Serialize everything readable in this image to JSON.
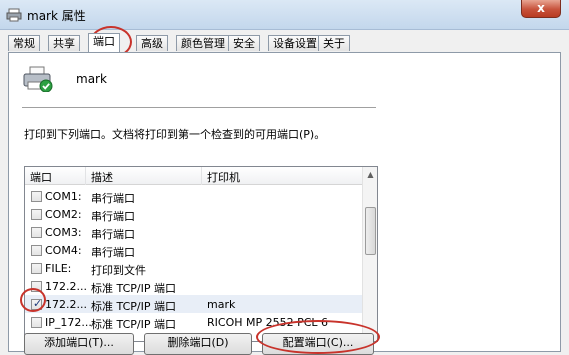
{
  "window": {
    "title": "mark 属性",
    "close_label": "x"
  },
  "tabs": [
    {
      "label": "常规"
    },
    {
      "label": "共享"
    },
    {
      "label": "端口"
    },
    {
      "label": "高级"
    },
    {
      "label": "颜色管理"
    },
    {
      "label": "安全"
    },
    {
      "label": "设备设置"
    },
    {
      "label": "关于"
    }
  ],
  "active_tab": "端口",
  "printer": {
    "name": "mark",
    "icon": "printer-icon"
  },
  "instruction": "打印到下列端口。文档将打印到第一个检查到的可用端口(P)。",
  "port_list": {
    "columns": [
      "端口",
      "描述",
      "打印机"
    ],
    "rows": [
      {
        "port": "COM1:",
        "description": "串行端口",
        "printer": "",
        "checked": false
      },
      {
        "port": "COM2:",
        "description": "串行端口",
        "printer": "",
        "checked": false
      },
      {
        "port": "COM3:",
        "description": "串行端口",
        "printer": "",
        "checked": false
      },
      {
        "port": "COM4:",
        "description": "串行端口",
        "printer": "",
        "checked": false
      },
      {
        "port": "FILE:",
        "description": "打印到文件",
        "printer": "",
        "checked": false
      },
      {
        "port": "172.2...",
        "description": "标准 TCP/IP 端口",
        "printer": "",
        "checked": false
      },
      {
        "port": "172.2...",
        "description": "标准 TCP/IP 端口",
        "printer": "mark",
        "checked": true
      },
      {
        "port": "IP_172...",
        "description": "标准 TCP/IP 端口",
        "printer": "RICOH MP 2552 PCL 6",
        "checked": false
      }
    ]
  },
  "buttons": {
    "add_port": "添加端口(T)...",
    "delete_port": "删除端口(D)",
    "configure_port": "配置端口(C)..."
  },
  "colors": {
    "highlight_ellipse": "#c8332b",
    "selected_row": "#e8eef7"
  }
}
